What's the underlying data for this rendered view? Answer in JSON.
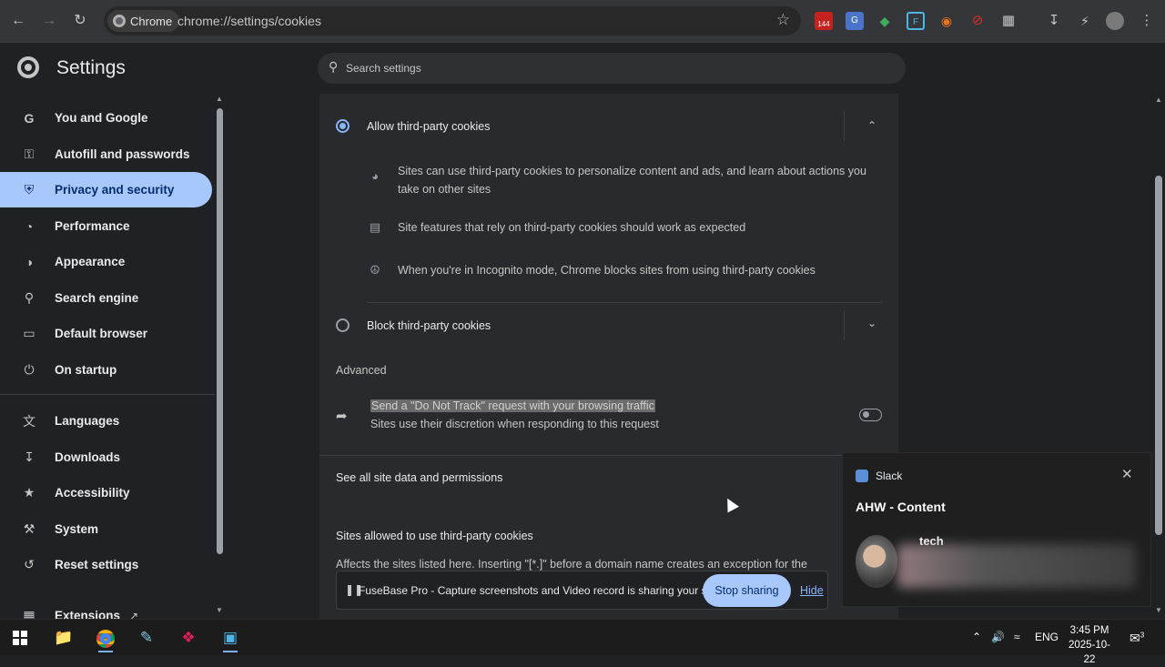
{
  "browser": {
    "chip_label": "Chrome",
    "url": "chrome://settings/cookies",
    "ext_badge": "144"
  },
  "settings": {
    "title": "Settings",
    "search_placeholder": "Search settings"
  },
  "sidebar": {
    "items": [
      {
        "label": "You and Google",
        "icon": "google-icon"
      },
      {
        "label": "Autofill and passwords",
        "icon": "key-icon"
      },
      {
        "label": "Privacy and security",
        "icon": "shield-icon"
      },
      {
        "label": "Performance",
        "icon": "speedometer-icon"
      },
      {
        "label": "Appearance",
        "icon": "palette-icon"
      },
      {
        "label": "Search engine",
        "icon": "search-icon"
      },
      {
        "label": "Default browser",
        "icon": "browser-window-icon"
      },
      {
        "label": "On startup",
        "icon": "power-icon"
      },
      {
        "label": "Languages",
        "icon": "translate-icon"
      },
      {
        "label": "Downloads",
        "icon": "download-icon"
      },
      {
        "label": "Accessibility",
        "icon": "accessibility-icon"
      },
      {
        "label": "System",
        "icon": "wrench-icon"
      },
      {
        "label": "Reset settings",
        "icon": "reset-icon"
      },
      {
        "label": "Extensions",
        "icon": "puzzle-icon"
      }
    ]
  },
  "cookies": {
    "allow_label": "Allow third-party cookies",
    "allow_details": [
      "Sites can use third-party cookies to personalize content and ads, and learn about actions you take on other sites",
      "Site features that rely on third-party cookies should work as expected",
      "When you're in Incognito mode, Chrome blocks sites from using third-party cookies"
    ],
    "block_label": "Block third-party cookies",
    "advanced_heading": "Advanced",
    "dnt_title": "Send a \"Do Not Track\" request with your browsing traffic",
    "dnt_subtitle": "Sites use their discretion when responding to this request",
    "see_all_label": "See all site data and permissions",
    "sites_allowed_heading": "Sites allowed to use third-party cookies",
    "sites_allowed_desc": "Affects the sites listed here. Inserting \"[*.]\" before a domain name creates an exception for the"
  },
  "share_bar": {
    "text": "FuseBase Pro - Capture screenshots and Video record is sharing your screen.",
    "stop_label": "Stop sharing",
    "hide_label": "Hide"
  },
  "toast": {
    "app_name": "Slack",
    "title": "AHW - Content",
    "sender": "tech"
  },
  "taskbar": {
    "language": "ENG",
    "time": "3:45 PM",
    "date": "2025-10-22",
    "notification_count": "3"
  }
}
